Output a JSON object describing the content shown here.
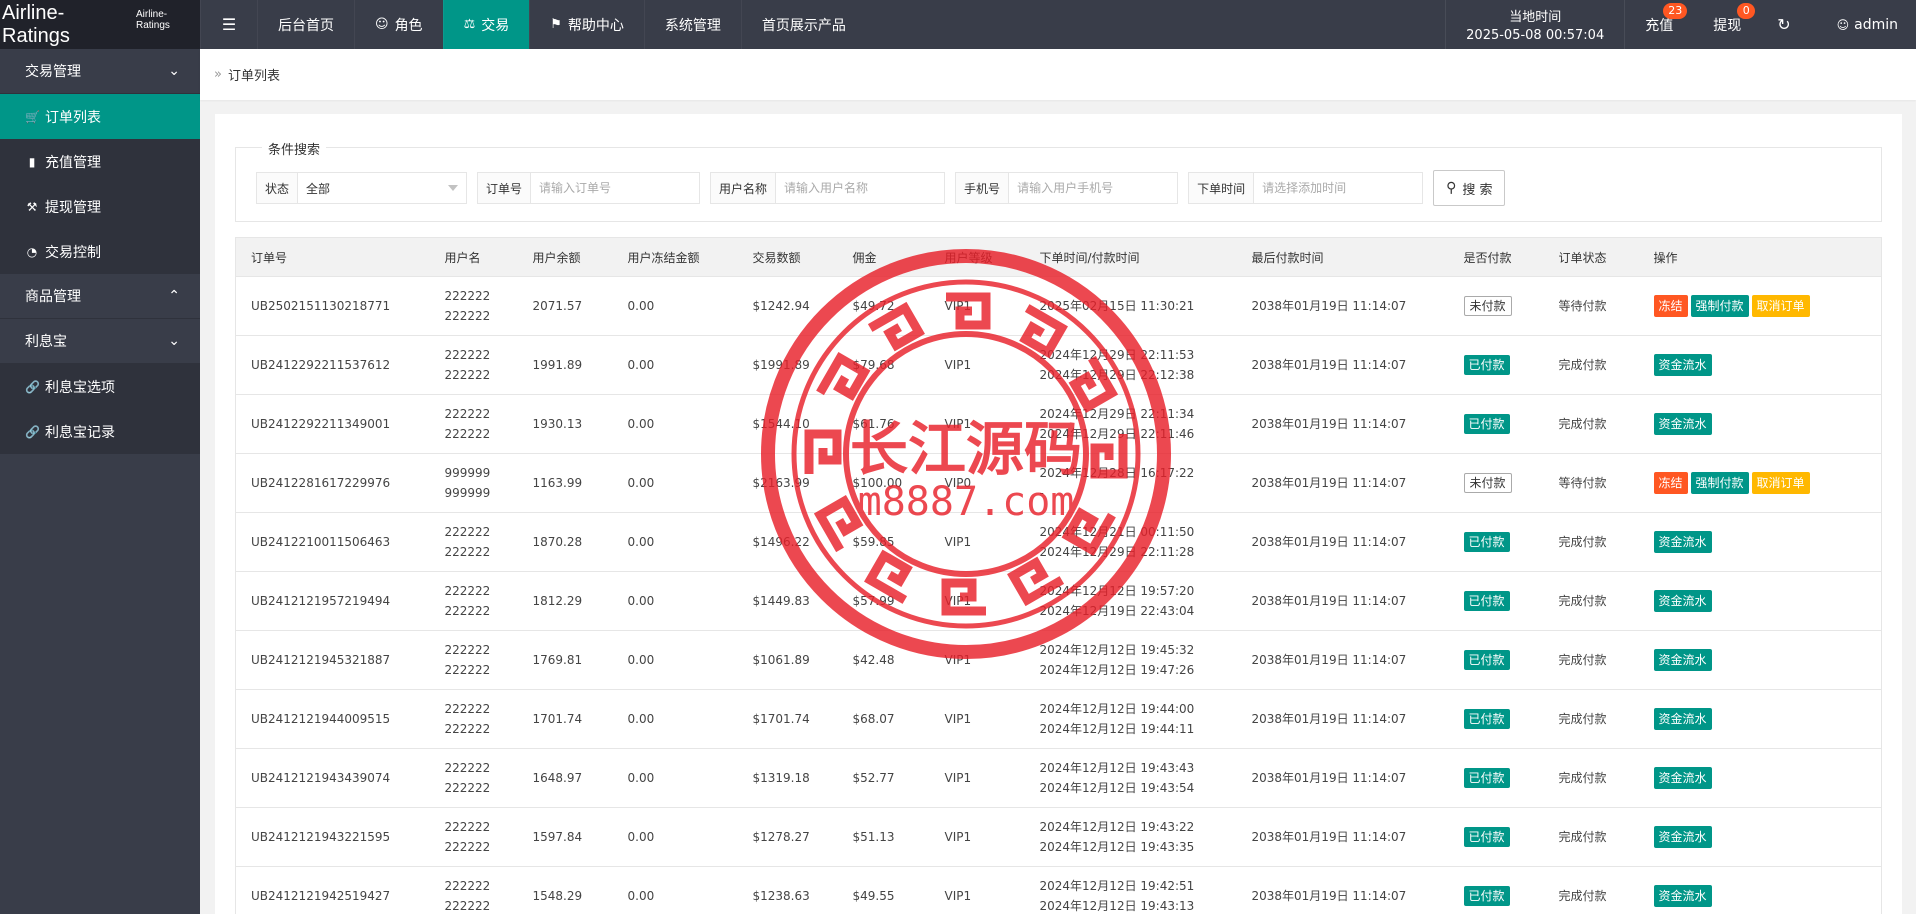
{
  "header": {
    "logo_main": "Airline-Ratings",
    "logo_sub": "Airline-Ratings",
    "nav": [
      {
        "label": "后台首页",
        "icon": ""
      },
      {
        "label": "角色",
        "icon": "user-icon"
      },
      {
        "label": "交易",
        "icon": "scale-icon",
        "active": true
      },
      {
        "label": "帮助中心",
        "icon": "flag-icon"
      },
      {
        "label": "系统管理",
        "icon": ""
      },
      {
        "label": "首页展示产品",
        "icon": ""
      }
    ],
    "time_label": "当地时间",
    "time_value": "2025-05-08 00:57:04",
    "recharge_label": "充值",
    "recharge_badge": "23",
    "withdraw_label": "提现",
    "withdraw_badge": "0",
    "user": "admin"
  },
  "sidebar": {
    "groups": [
      {
        "label": "交易管理",
        "items": [
          {
            "label": "订单列表",
            "icon": "cart-icon",
            "active": true
          },
          {
            "label": "充值管理",
            "icon": "chat-icon"
          },
          {
            "label": "提现管理",
            "icon": "gavel-icon"
          },
          {
            "label": "交易控制",
            "icon": "gauge-icon"
          }
        ]
      },
      {
        "label": "商品管理",
        "items": []
      },
      {
        "label": "利息宝",
        "items": [
          {
            "label": "利息宝选项",
            "icon": "link-icon"
          },
          {
            "label": "利息宝记录",
            "icon": "link-icon"
          }
        ]
      }
    ]
  },
  "breadcrumb": "订单列表",
  "search": {
    "legend": "条件搜索",
    "status_label": "状态",
    "status_value": "全部",
    "order_label": "订单号",
    "order_placeholder": "请输入订单号",
    "username_label": "用户名称",
    "username_placeholder": "请输入用户名称",
    "phone_label": "手机号",
    "phone_placeholder": "请输入用户手机号",
    "time_label": "下单时间",
    "time_placeholder": "请选择添加时间",
    "button": "搜 索"
  },
  "table": {
    "headers": [
      "订单号",
      "用户名",
      "用户余额",
      "用户冻结金额",
      "交易数额",
      "佣金",
      "用户等级",
      "下单时间/付款时间",
      "最后付款时间",
      "是否付款",
      "订单状态",
      "操作"
    ],
    "rows": [
      {
        "id": "UB2502151130218771",
        "user1": "222222",
        "user2": "222222",
        "balance": "2071.57",
        "frozen": "0.00",
        "amount": "$1242.94",
        "commission": "$49.72",
        "level": "VIP1",
        "t1": "2025年02月15日 11:30:21",
        "t2": "",
        "last": "2038年01月19日 11:14:07",
        "paid": false,
        "paid_label": "未付款",
        "status": "等待付款",
        "actions": [
          "冻结",
          "强制付款",
          "取消订单"
        ]
      },
      {
        "id": "UB2412292211537612",
        "user1": "222222",
        "user2": "222222",
        "balance": "1991.89",
        "frozen": "0.00",
        "amount": "$1991.89",
        "commission": "$79.68",
        "level": "VIP1",
        "t1": "2024年12月29日 22:11:53",
        "t2": "2024年12月29日 22:12:38",
        "last": "2038年01月19日 11:14:07",
        "paid": true,
        "paid_label": "已付款",
        "status": "完成付款",
        "actions": [
          "资金流水"
        ]
      },
      {
        "id": "UB2412292211349001",
        "user1": "222222",
        "user2": "222222",
        "balance": "1930.13",
        "frozen": "0.00",
        "amount": "$1544.10",
        "commission": "$61.76",
        "level": "VIP1",
        "t1": "2024年12月29日 22:11:34",
        "t2": "2024年12月29日 22:11:46",
        "last": "2038年01月19日 11:14:07",
        "paid": true,
        "paid_label": "已付款",
        "status": "完成付款",
        "actions": [
          "资金流水"
        ]
      },
      {
        "id": "UB2412281617229976",
        "user1": "999999",
        "user2": "999999",
        "balance": "1163.99",
        "frozen": "0.00",
        "amount": "$2163.99",
        "commission": "$100.00",
        "level": "VIP0",
        "t1": "2024年12月28日 16:17:22",
        "t2": "-",
        "last": "2038年01月19日 11:14:07",
        "paid": false,
        "paid_label": "未付款",
        "status": "等待付款",
        "actions": [
          "冻结",
          "强制付款",
          "取消订单"
        ]
      },
      {
        "id": "UB2412210011506463",
        "user1": "222222",
        "user2": "222222",
        "balance": "1870.28",
        "frozen": "0.00",
        "amount": "$1496.22",
        "commission": "$59.85",
        "level": "VIP1",
        "t1": "2024年12月21日 00:11:50",
        "t2": "2024年12月29日 22:11:28",
        "last": "2038年01月19日 11:14:07",
        "paid": true,
        "paid_label": "已付款",
        "status": "完成付款",
        "actions": [
          "资金流水"
        ]
      },
      {
        "id": "UB2412121957219494",
        "user1": "222222",
        "user2": "222222",
        "balance": "1812.29",
        "frozen": "0.00",
        "amount": "$1449.83",
        "commission": "$57.99",
        "level": "VIP1",
        "t1": "2024年12月12日 19:57:20",
        "t2": "2024年12月19日 22:43:04",
        "last": "2038年01月19日 11:14:07",
        "paid": true,
        "paid_label": "已付款",
        "status": "完成付款",
        "actions": [
          "资金流水"
        ]
      },
      {
        "id": "UB2412121945321887",
        "user1": "222222",
        "user2": "222222",
        "balance": "1769.81",
        "frozen": "0.00",
        "amount": "$1061.89",
        "commission": "$42.48",
        "level": "VIP1",
        "t1": "2024年12月12日 19:45:32",
        "t2": "2024年12月12日 19:47:26",
        "last": "2038年01月19日 11:14:07",
        "paid": true,
        "paid_label": "已付款",
        "status": "完成付款",
        "actions": [
          "资金流水"
        ]
      },
      {
        "id": "UB2412121944009515",
        "user1": "222222",
        "user2": "222222",
        "balance": "1701.74",
        "frozen": "0.00",
        "amount": "$1701.74",
        "commission": "$68.07",
        "level": "VIP1",
        "t1": "2024年12月12日 19:44:00",
        "t2": "2024年12月12日 19:44:11",
        "last": "2038年01月19日 11:14:07",
        "paid": true,
        "paid_label": "已付款",
        "status": "完成付款",
        "actions": [
          "资金流水"
        ]
      },
      {
        "id": "UB2412121943439074",
        "user1": "222222",
        "user2": "222222",
        "balance": "1648.97",
        "frozen": "0.00",
        "amount": "$1319.18",
        "commission": "$52.77",
        "level": "VIP1",
        "t1": "2024年12月12日 19:43:43",
        "t2": "2024年12月12日 19:43:54",
        "last": "2038年01月19日 11:14:07",
        "paid": true,
        "paid_label": "已付款",
        "status": "完成付款",
        "actions": [
          "资金流水"
        ]
      },
      {
        "id": "UB2412121943221595",
        "user1": "222222",
        "user2": "222222",
        "balance": "1597.84",
        "frozen": "0.00",
        "amount": "$1278.27",
        "commission": "$51.13",
        "level": "VIP1",
        "t1": "2024年12月12日 19:43:22",
        "t2": "2024年12月12日 19:43:35",
        "last": "2038年01月19日 11:14:07",
        "paid": true,
        "paid_label": "已付款",
        "status": "完成付款",
        "actions": [
          "资金流水"
        ]
      },
      {
        "id": "UB2412121942519427",
        "user1": "222222",
        "user2": "222222",
        "balance": "1548.29",
        "frozen": "0.00",
        "amount": "$1238.63",
        "commission": "$49.55",
        "level": "VIP1",
        "t1": "2024年12月12日 19:42:51",
        "t2": "2024年12月12日 19:43:13",
        "last": "2038年01月19日 11:14:07",
        "paid": true,
        "paid_label": "已付款",
        "status": "完成付款",
        "actions": [
          "资金流水"
        ]
      }
    ]
  },
  "watermark": {
    "line1": "长江源码",
    "line2": "m8887.com"
  },
  "colors": {
    "accent": "#009688",
    "dark": "#393d49",
    "danger": "#ff5722",
    "warn": "#ffb800",
    "seal": "#e8202a"
  }
}
